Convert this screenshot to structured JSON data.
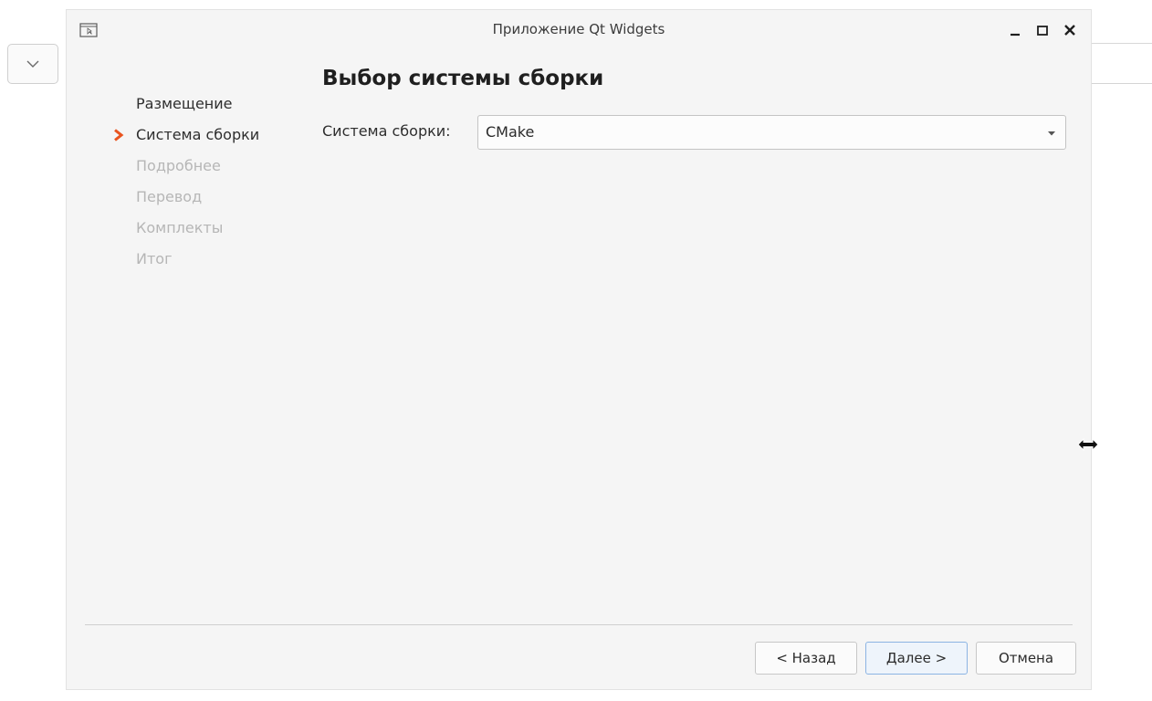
{
  "window": {
    "title": "Приложение Qt Widgets"
  },
  "icons": {
    "app": "app-window-icon",
    "minimize": "minimize-icon",
    "maximize": "maximize-icon",
    "close": "close-icon",
    "current_step": "chevron-right-icon",
    "dropdown": "chevron-down-icon",
    "cursor": "resize-horizontal-cursor-icon"
  },
  "steps": [
    {
      "label": "Размещение",
      "state": "done"
    },
    {
      "label": "Система сборки",
      "state": "current"
    },
    {
      "label": "Подробнее",
      "state": "disabled"
    },
    {
      "label": "Перевод",
      "state": "disabled"
    },
    {
      "label": "Комплекты",
      "state": "disabled"
    },
    {
      "label": "Итог",
      "state": "disabled"
    }
  ],
  "page": {
    "title": "Выбор системы сборки",
    "build_system_label": "Система сборки:",
    "build_system_value": "CMake"
  },
  "buttons": {
    "back": "< Назад",
    "next": "Далее >",
    "cancel": "Отмена"
  },
  "colors": {
    "accent_arrow": "#e9541f",
    "default_button_border": "#8cb4e3"
  }
}
